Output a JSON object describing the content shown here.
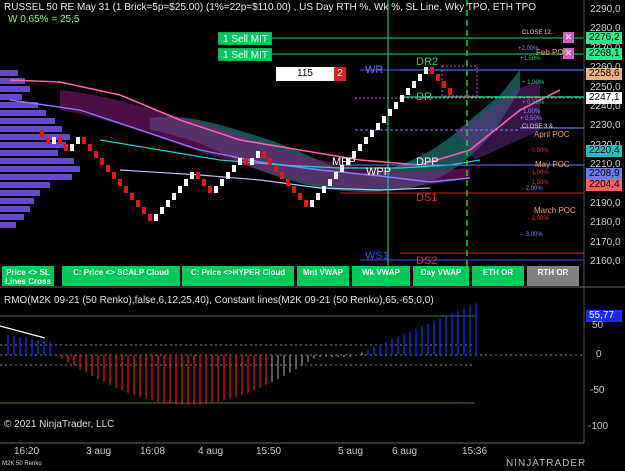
{
  "header": {
    "title": "RUSSEL 50 RE May 31 (1 Brick=5p=$25.00) (1%=22p=$110.00)  , US Day RTH %, Wk %, SL Line, Wky TPO, ETH TPO",
    "subtitle": "W 0,65% = 25,5"
  },
  "orders": [
    {
      "label": "1  Sell MIT",
      "price": "2276,2"
    },
    {
      "label": "1  Sell MIT",
      "price": "2268,1"
    }
  ],
  "quantity": {
    "value": "115",
    "count": "2"
  },
  "price_axis": [
    "2290,0",
    "2280,0",
    "2270,0",
    "2260,0",
    "2250,0",
    "2240,0",
    "2230,0",
    "2220,0",
    "2210,0",
    "2200,0",
    "2190,0",
    "2180,0",
    "2170,0",
    "2160,0"
  ],
  "price_boxes": [
    {
      "value": "2276,2",
      "color": "#2ee88a"
    },
    {
      "value": "2268,1",
      "color": "#2ee88a"
    },
    {
      "value": "2258,6",
      "color": "#f0b080"
    },
    {
      "value": "2247,1",
      "color": "#ffffff"
    },
    {
      "value": "2220,4",
      "color": "#20c0c0"
    },
    {
      "value": "2208,9",
      "color": "#6b7cf0"
    },
    {
      "value": "2204,4",
      "color": "#ff6060"
    }
  ],
  "levels": [
    "WR",
    "DR2",
    "DR",
    "MPP",
    "DPP",
    "WPP",
    "DS1",
    "WS1",
    "DS2"
  ],
  "right_labels": [
    "CLOSE 12..",
    "Feb POC",
    "+1,50%",
    "+2,00%",
    "+ 1,00%",
    "+ 0,50%",
    "+ 0,50%",
    "+ 1,00%",
    "CLOSE 3 &..",
    "April POC",
    "- 0,50%",
    "May POC",
    "- 1,00%",
    "- 1,50%",
    "- 2,00%",
    "March POC",
    "- 2,00%",
    "- 3,00%"
  ],
  "buttons": [
    {
      "label": "Price <> SL Lines Cross",
      "color": "#00c85a"
    },
    {
      "label": "C: Price <> SCALP Cloud",
      "color": "#00c85a"
    },
    {
      "label": "C: Price <>HYPER Cloud",
      "color": "#00c85a"
    },
    {
      "label": "Mnt VWAP",
      "color": "#00c85a"
    },
    {
      "label": "Wk VWAP",
      "color": "#00c85a"
    },
    {
      "label": "Day VWAP",
      "color": "#00c85a"
    },
    {
      "label": "ETH OR",
      "color": "#00c85a"
    },
    {
      "label": "RTH OR",
      "color": "#808080"
    }
  ],
  "indicator": {
    "label": "RMO(M2K 09-21 (50 Renko),false,6,12,25,40), Constant lines(M2K 09-21 (50 Renko),65,-65,0,0)",
    "value": "55,77",
    "axis": [
      "50",
      "0",
      "-50",
      "-100"
    ]
  },
  "time_axis": [
    "16:20",
    "3 aug",
    "16:08",
    "4 aug",
    "15:50",
    "5 aug",
    "6 aug",
    "15:36"
  ],
  "copyright": "© 2021 NinjaTrader, LLC",
  "instrument": "M2K 50 Renko",
  "brand": "NINJATRADER",
  "colors": {
    "up": "#ffffff",
    "down": "#e01818",
    "histo_pos": "#1a2cf0",
    "histo_neg": "#e01818",
    "buy": "#00c85a"
  }
}
